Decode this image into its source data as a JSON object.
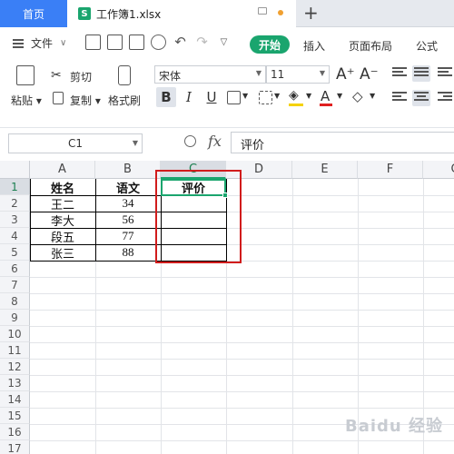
{
  "tabs": {
    "home": "首页",
    "file": "工作簿1.xlsx",
    "file_icon": "S",
    "add": "+"
  },
  "menu": {
    "file_label": "文件",
    "start": "开始",
    "insert": "插入",
    "page_layout": "页面布局",
    "formula": "公式"
  },
  "ribbon": {
    "paste": "粘贴",
    "cut": "剪切",
    "copy": "复制",
    "format_painter": "格式刷",
    "font_name": "宋体",
    "font_size": "11",
    "bold": "B",
    "italic": "I",
    "underline": "U",
    "font_grow": "A⁺",
    "font_shrink": "A⁻"
  },
  "formula_bar": {
    "name_box": "C1",
    "fx": "fx",
    "content": "评价"
  },
  "grid": {
    "columns": [
      "A",
      "B",
      "C",
      "D",
      "E",
      "F",
      "G"
    ],
    "rows": [
      "1",
      "2",
      "3",
      "4",
      "5",
      "6",
      "7",
      "8",
      "9",
      "10",
      "11",
      "12",
      "13",
      "14",
      "15",
      "16",
      "17"
    ],
    "header": {
      "name": "姓名",
      "chinese": "语文",
      "rating": "评价"
    },
    "data": [
      {
        "name": "王二",
        "score": "34",
        "rating": ""
      },
      {
        "name": "李大",
        "score": "56",
        "rating": ""
      },
      {
        "name": "段五",
        "score": "77",
        "rating": ""
      },
      {
        "name": "张三",
        "score": "88",
        "rating": ""
      }
    ],
    "active_cell": "C1"
  },
  "watermark": "Baidu 经验",
  "colors": {
    "accent": "#1aa56e",
    "tab_active": "#3a7ff6",
    "annotation": "#d11c1c"
  }
}
